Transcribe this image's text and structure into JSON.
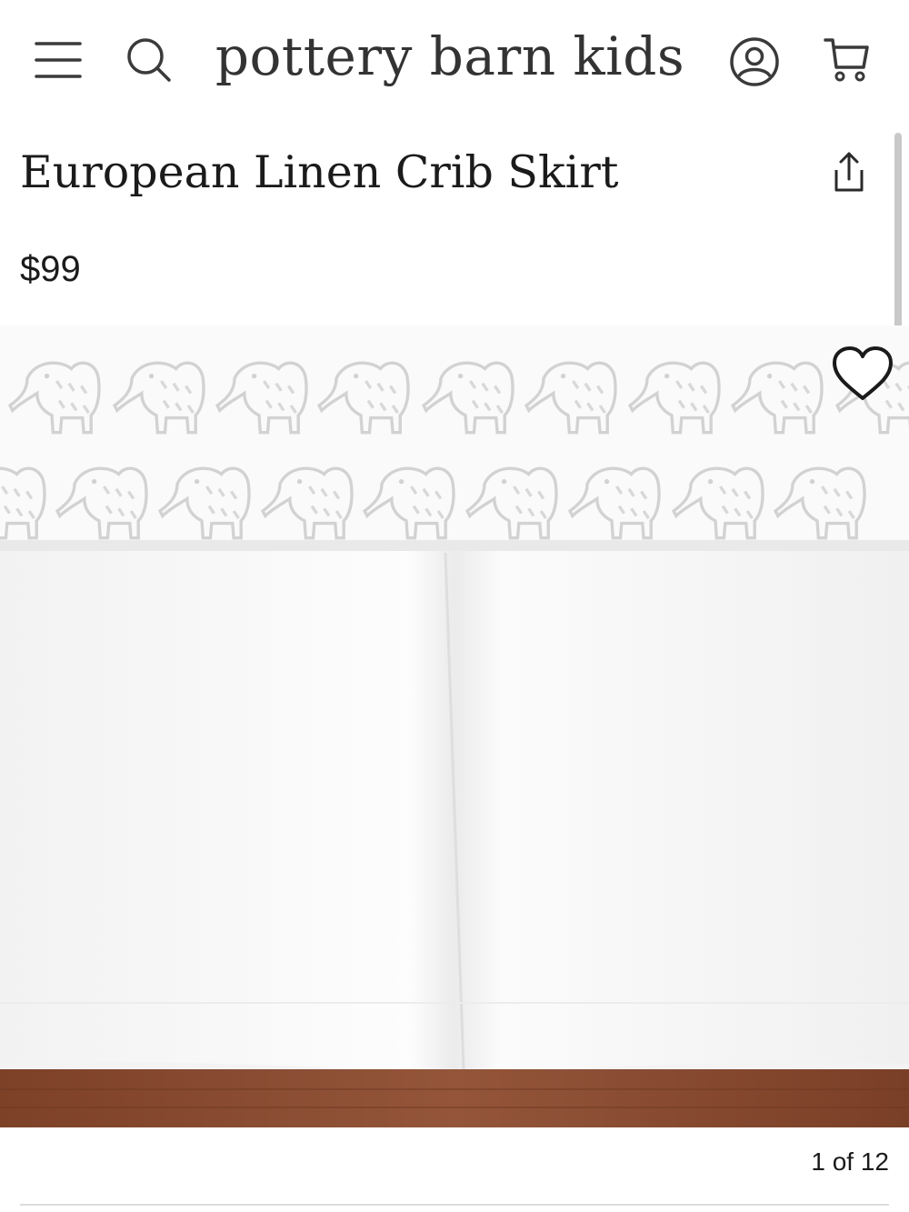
{
  "header": {
    "logo": "pottery barn kids",
    "icons": [
      "hamburger-menu-icon",
      "search-icon",
      "account-icon",
      "cart-icon"
    ]
  },
  "product": {
    "title": "European Linen Crib Skirt",
    "price": "$99"
  },
  "gallery": {
    "counter": "1 of 12",
    "icons": [
      "share-icon",
      "heart-icon"
    ]
  },
  "colors": {
    "text": "#1f1f1f",
    "logo": "#333333",
    "pattern": "#d4d4d4",
    "floor": "#8a4a30"
  }
}
